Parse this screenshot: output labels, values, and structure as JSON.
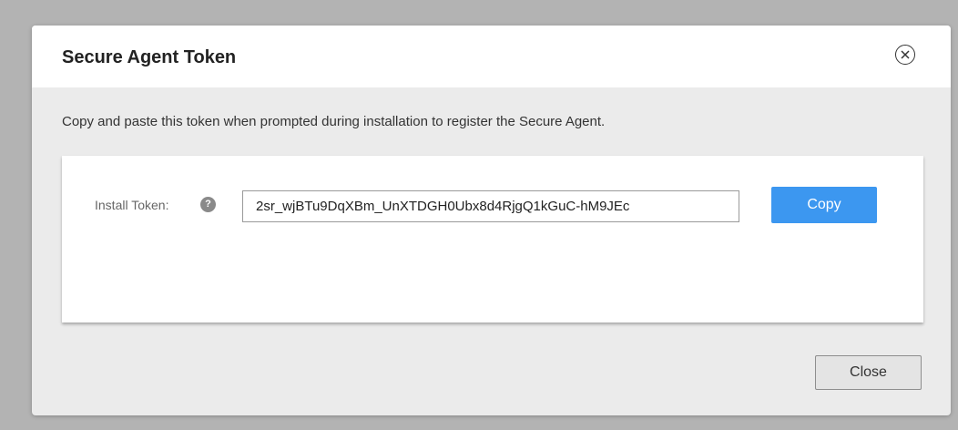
{
  "dialog": {
    "title": "Secure Agent Token",
    "description": "Copy and paste this token when prompted during installation to register the Secure Agent.",
    "close_icon": "close-circle-icon"
  },
  "token": {
    "label": "Install Token:",
    "help_icon": "help-icon",
    "help_glyph": "?",
    "value": "2sr_wjBTu9DqXBm_UnXTDGH0Ubx8d4RjgQ1kGuC-hM9JEc",
    "copy_label": "Copy"
  },
  "footer": {
    "close_label": "Close"
  },
  "colors": {
    "accent": "#3c97f0",
    "backdrop": "#b3b3b3",
    "dialog_body": "#ebebeb"
  }
}
